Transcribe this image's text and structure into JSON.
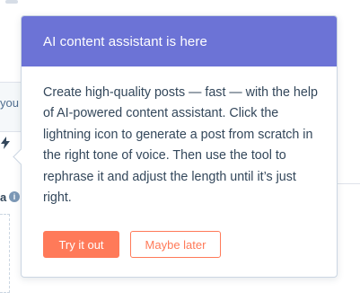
{
  "background": {
    "truncated_text": "you",
    "field_label_fragment": "a",
    "info_icon_glyph": "i"
  },
  "popover": {
    "title": "AI content assistant is here",
    "body": "Create high-quality posts — fast — with the help of AI-powered content assistant. Click the lightning icon to generate a post from scratch in the right tone of voice. Then use the tool to rephrase it and adjust the length until it’s just right.",
    "primary_button_label": "Try it out",
    "secondary_button_label": "Maybe later"
  },
  "colors": {
    "header": "#6c73d6",
    "accent": "#ff7a59",
    "text": "#33475b"
  }
}
